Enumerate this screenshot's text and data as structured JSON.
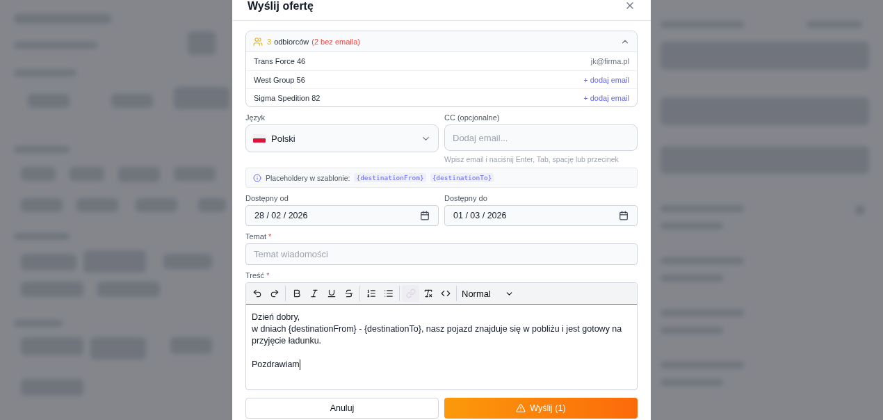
{
  "dialog": {
    "title": "Wyślij ofertę"
  },
  "recipients": {
    "count": "3",
    "label": "odbiorców",
    "warning": "(2 bez emaila)",
    "expanded": true,
    "rows": [
      {
        "name": "Trans Force 46",
        "kind": "email",
        "value": "jk@firma.pl"
      },
      {
        "name": "West Group 56",
        "kind": "add",
        "value": "+ dodaj email"
      },
      {
        "name": "Sigma Spedition 82",
        "kind": "add",
        "value": "+ dodaj email"
      }
    ]
  },
  "language": {
    "label": "Język",
    "value": "Polski"
  },
  "cc": {
    "label": "CC (opcjonalne)",
    "placeholder": "Dodaj email...",
    "hint": "Wpisz email i naciśnij Enter, Tab, spację lub przecinek"
  },
  "info": {
    "text": "Placeholdery w szablonie:",
    "tags": [
      "{destinationFrom}",
      "{destinationTo}"
    ]
  },
  "dates": [
    {
      "label": "Dostępny od",
      "value": "28 / 02 / 2026"
    },
    {
      "label": "Dostępny do",
      "value": "01 / 03 / 2026"
    }
  ],
  "subject": {
    "label": "Temat",
    "required_mark": "*",
    "placeholder": "Temat wiadomości"
  },
  "body": {
    "label": "Treść",
    "required_mark": "*",
    "tools": [
      {
        "kind": "undo",
        "disabled": false
      },
      {
        "kind": "redo",
        "disabled": false
      },
      {
        "kind": "bold",
        "disabled": false
      },
      {
        "kind": "italic",
        "disabled": false
      },
      {
        "kind": "underline",
        "disabled": false
      },
      {
        "kind": "strike",
        "disabled": false
      },
      {
        "kind": "ordered",
        "disabled": false
      },
      {
        "kind": "bullets",
        "disabled": false
      },
      {
        "kind": "link",
        "disabled": true
      },
      {
        "kind": "clear",
        "disabled": false
      },
      {
        "kind": "code",
        "disabled": false
      }
    ],
    "format": "Normal",
    "paragraphs": [
      [
        "Dzień dobry,",
        "w dniach {destinationFrom} - {destinationTo}, nasz pojazd znajduje się w pobliżu i jest gotowy na przyjęcie ładunku."
      ],
      [
        "Pozdrawiam"
      ]
    ]
  },
  "buttons": {
    "cancel": "Anuluj",
    "send": "Wyślij (1)"
  }
}
